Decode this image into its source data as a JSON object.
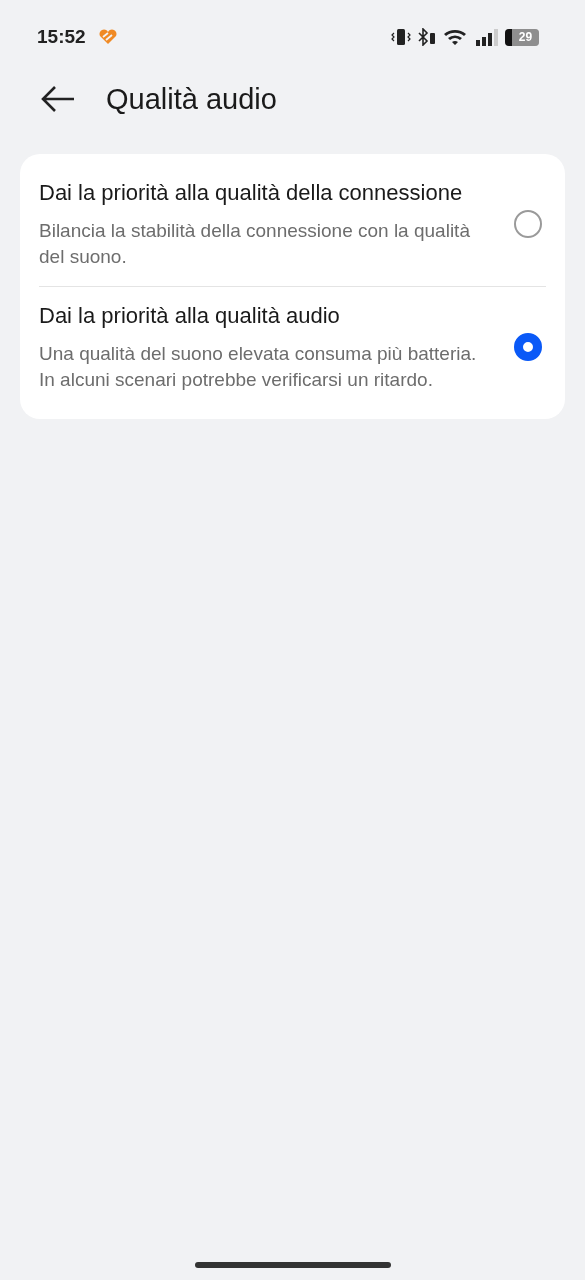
{
  "status_bar": {
    "time": "15:52",
    "battery": "29"
  },
  "header": {
    "title": "Qualità audio"
  },
  "options": [
    {
      "title": "Dai la priorità alla qualità della connessione",
      "description": "Bilancia la stabilità della connessione con la qualità del suono.",
      "selected": false
    },
    {
      "title": "Dai la priorità alla qualità audio",
      "description": "Una qualità del suono elevata consuma più batteria. In alcuni scenari potrebbe verificarsi un ritardo.",
      "selected": true
    }
  ]
}
